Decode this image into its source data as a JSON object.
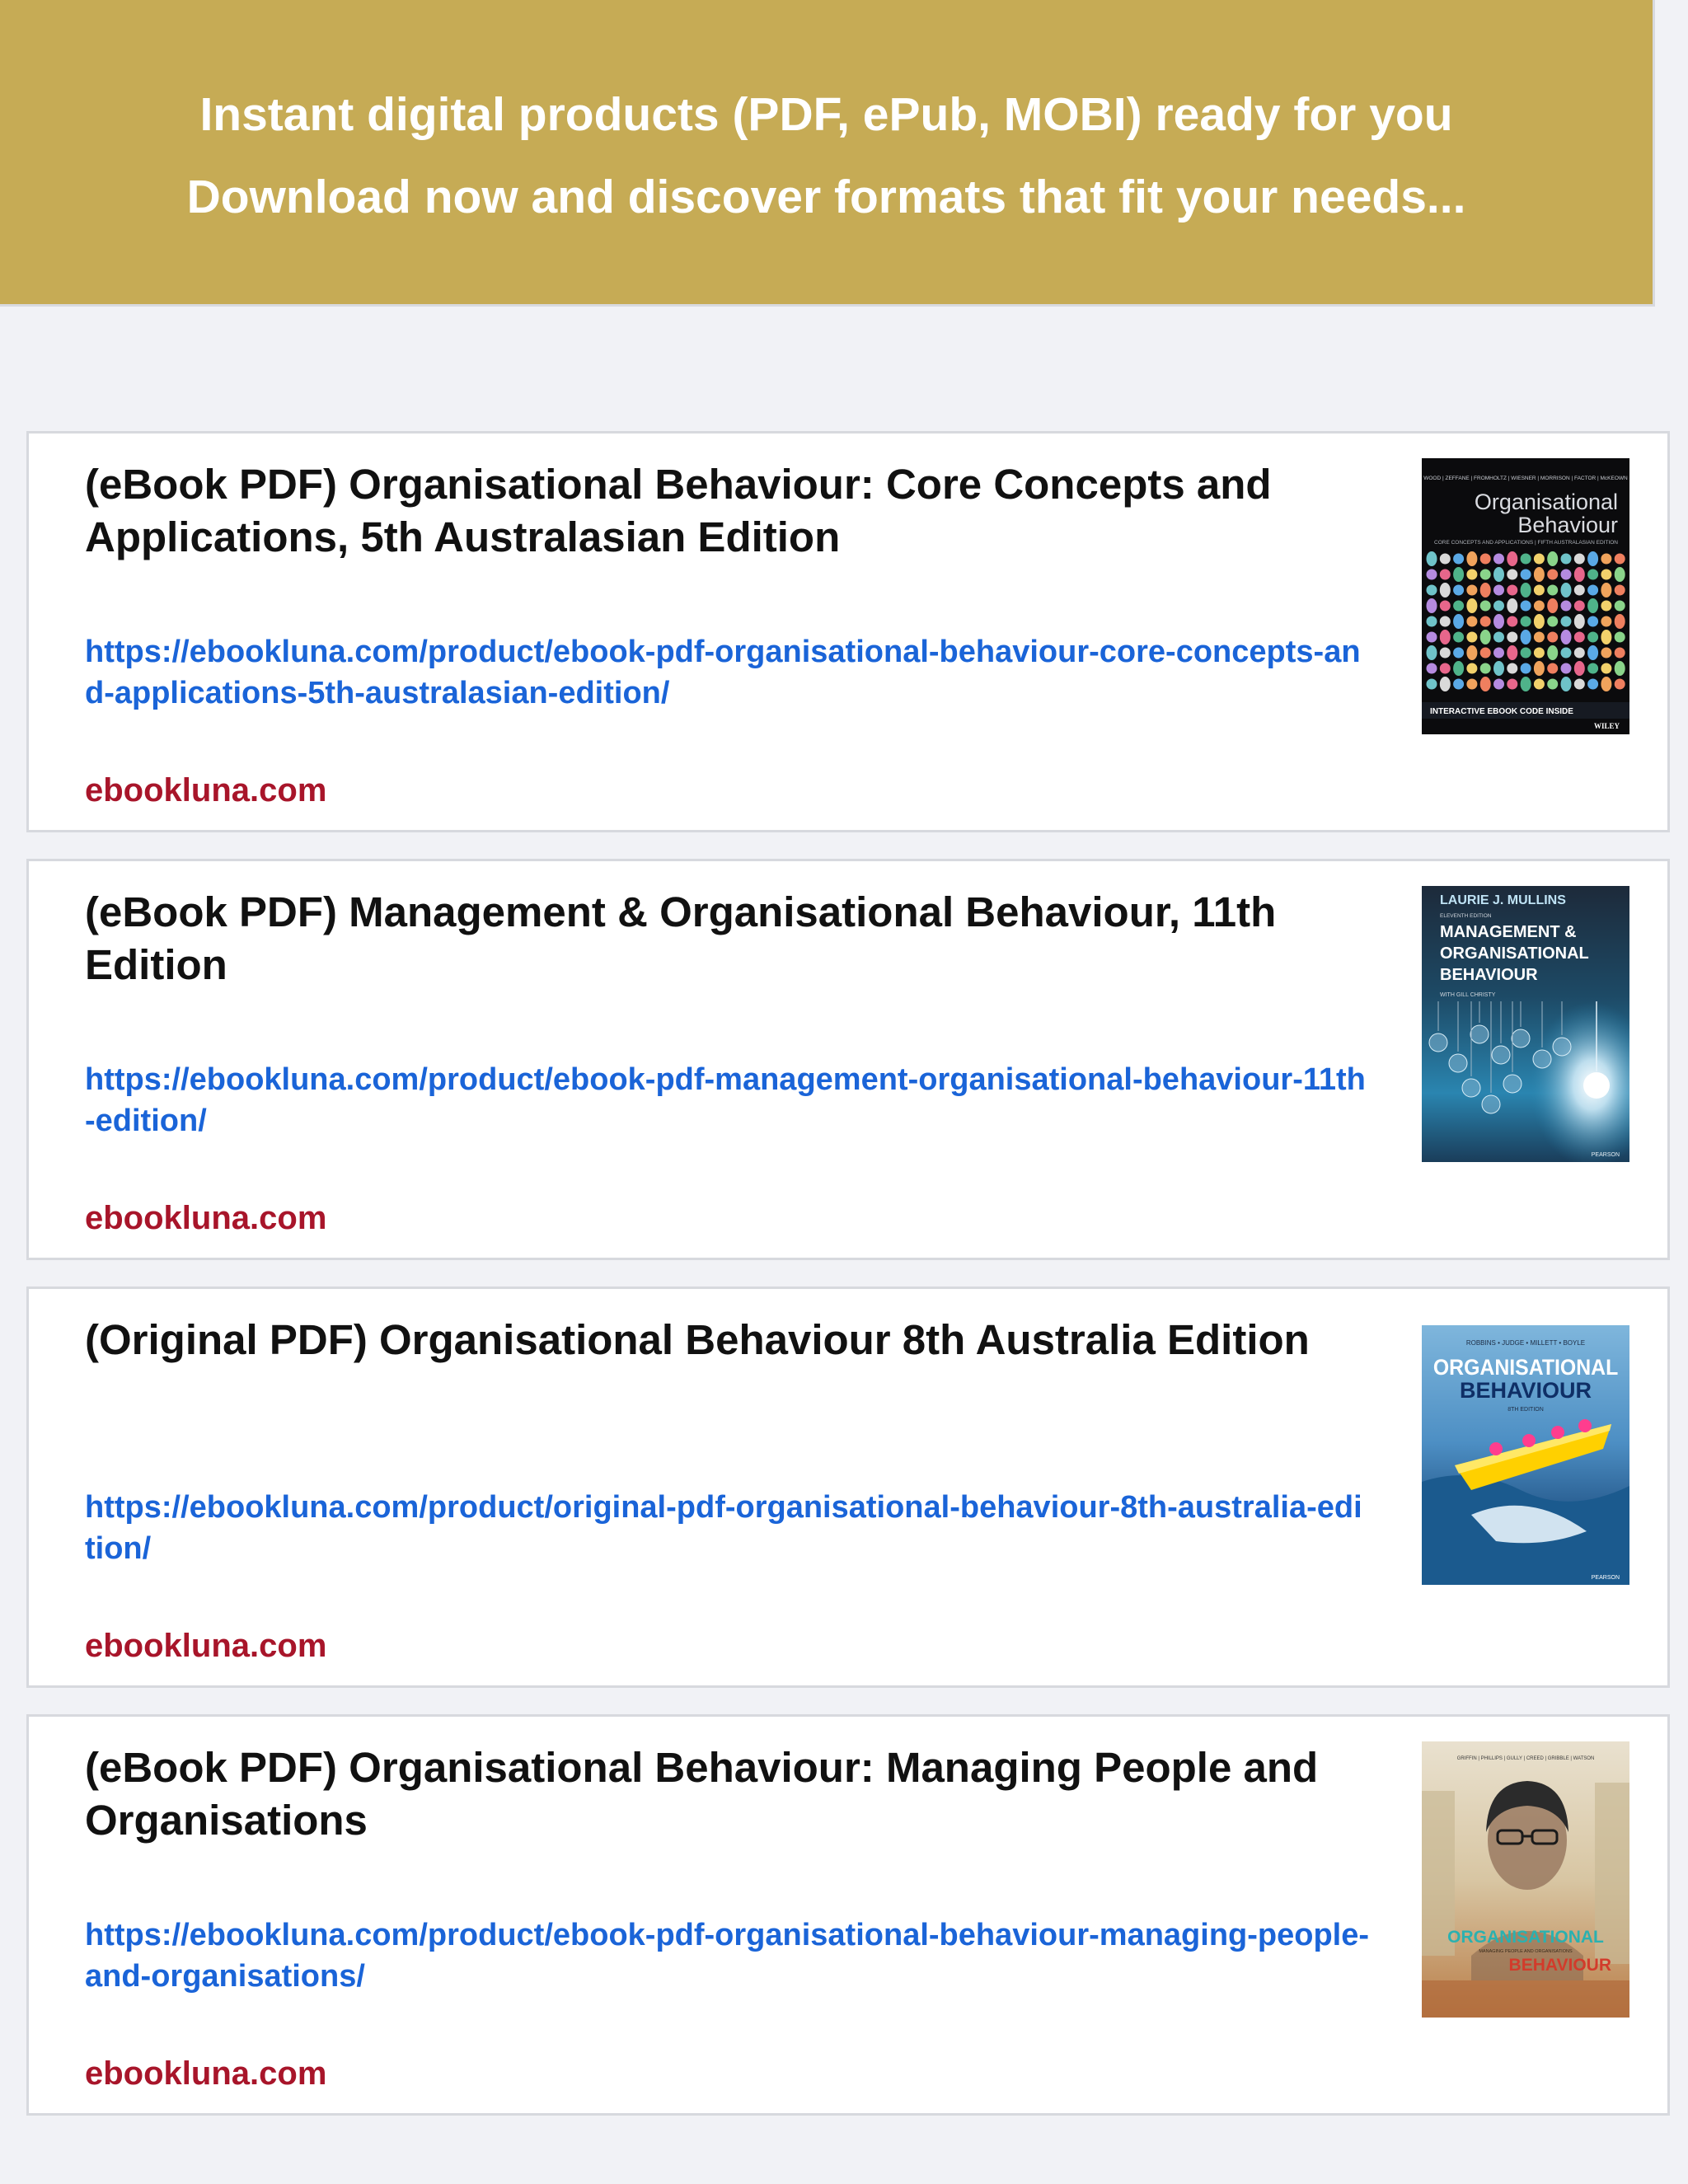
{
  "banner": {
    "line1": "Instant digital products (PDF, ePub, MOBI) ready for you",
    "line2": "Download now and discover formats that fit your needs..."
  },
  "products": [
    {
      "title": "(eBook PDF) Organisational Behaviour: Core Concepts and Applications, 5th Australasian Edition",
      "url": "https://ebookluna.com/product/ebook-pdf-organisational-behaviour-core-concepts-and-applications-5th-australasian-edition/",
      "source": "ebookluna.com",
      "cover": {
        "authors": "WOOD | ZEFFANE | FROMHOLTZ | WIESNER | MORRISON | FACTOR | McKEOWN",
        "title_line1": "Organisational",
        "title_line2": "Behaviour",
        "subtitle": "CORE CONCEPTS AND APPLICATIONS | FIFTH AUSTRALASIAN EDITION",
        "banner": "INTERACTIVE EBOOK CODE INSIDE",
        "publisher": "WILEY"
      }
    },
    {
      "title": "(eBook PDF) Management & Organisational Behaviour, 11th Edition",
      "url": "https://ebookluna.com/product/ebook-pdf-management-organisational-behaviour-11th-edition/",
      "source": "ebookluna.com",
      "cover": {
        "author": "LAURIE J. MULLINS",
        "edition": "ELEVENTH EDITION",
        "title_line1": "MANAGEMENT &",
        "title_line2": "ORGANISATIONAL",
        "title_line3": "BEHAVIOUR",
        "with": "WITH GILL CHRISTY",
        "publisher": "PEARSON"
      }
    },
    {
      "title": "(Original PDF) Organisational Behaviour 8th Australia Edition",
      "url": "https://ebookluna.com/product/original-pdf-organisational-behaviour-8th-australia-edition/",
      "source": "ebookluna.com",
      "cover": {
        "authors": "ROBBINS • JUDGE • MILLETT • BOYLE",
        "title_line1": "ORGANISATIONAL",
        "title_line2": "BEHAVIOUR",
        "edition": "8TH EDITION",
        "publisher": "PEARSON"
      }
    },
    {
      "title": "(eBook PDF) Organisational Behaviour: Managing People and Organisations",
      "url": "https://ebookluna.com/product/ebook-pdf-organisational-behaviour-managing-people-and-organisations/",
      "source": "ebookluna.com",
      "cover": {
        "authors": "GRIFFIN | PHILLIPS | GULLY | CREED | GRIBBLE | WATSON",
        "title_line1": "ORGANISATIONAL",
        "title_line2": "BEHAVIOUR",
        "subtitle": "MANAGING PEOPLE AND ORGANISATIONS"
      }
    }
  ]
}
